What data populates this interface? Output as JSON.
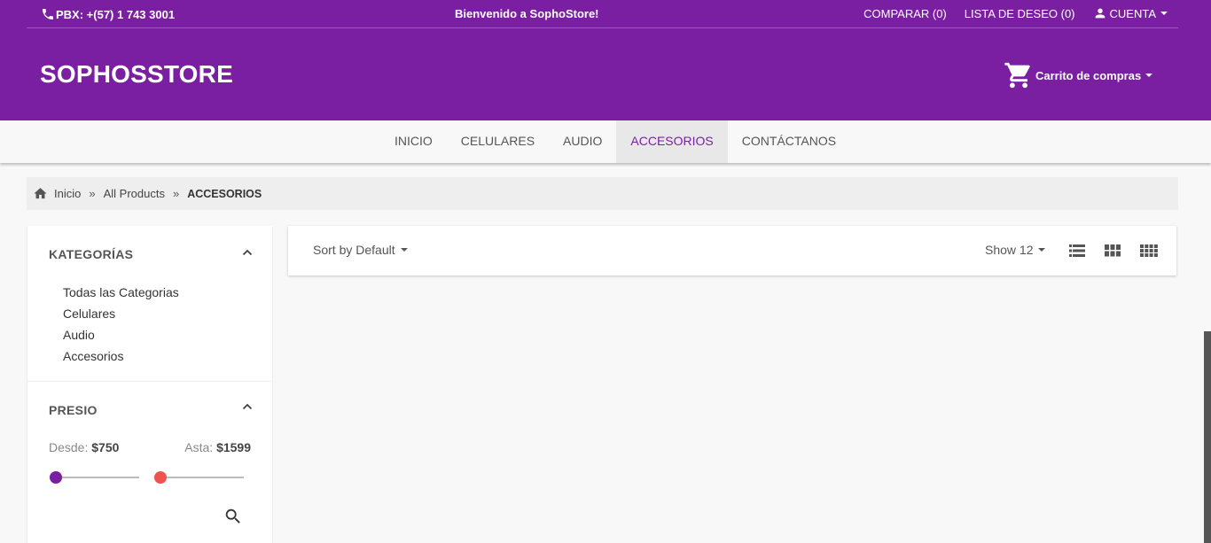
{
  "topbar": {
    "phone": "PBX: +(57) 1 743 3001",
    "welcome": "Bienvenido a SophoStore!",
    "compare": "COMPARAR (0)",
    "wishlist": "LISTA DE DESEO (0)",
    "account": "CUENTA"
  },
  "header": {
    "logo": "SOPHOSSTORE",
    "cart": "Carrito de compras"
  },
  "nav": {
    "items": [
      "INICIO",
      "CELULARES",
      "AUDIO",
      "ACCESORIOS",
      "CONTÁCTANOS"
    ],
    "active": "ACCESORIOS"
  },
  "breadcrumb": {
    "home": "Inicio",
    "sep": "»",
    "all": "All Products",
    "current": "ACCESORIOS"
  },
  "sidebar": {
    "categories_title": "KATEGORÍAS",
    "categories": [
      "Todas las Categorias",
      "Celulares",
      "Audio",
      "Accesorios"
    ],
    "price_title": "PRESIO",
    "from_label": "Desde:",
    "from_value": "$750",
    "to_label": "Asta:",
    "to_value": "$1599"
  },
  "toolbar": {
    "sort": "Sort by Default",
    "show": "Show 12"
  },
  "colors": {
    "primary": "#7b1fa2",
    "knob_min": "#7b1fa2",
    "knob_max": "#ef5350"
  },
  "icons": {
    "phone": "phone-icon",
    "account": "person-icon",
    "cart": "cart-icon",
    "home": "home-icon",
    "search": "search-icon",
    "views": [
      "list-view-icon",
      "grid-view-icon",
      "grid-small-view-icon"
    ]
  }
}
